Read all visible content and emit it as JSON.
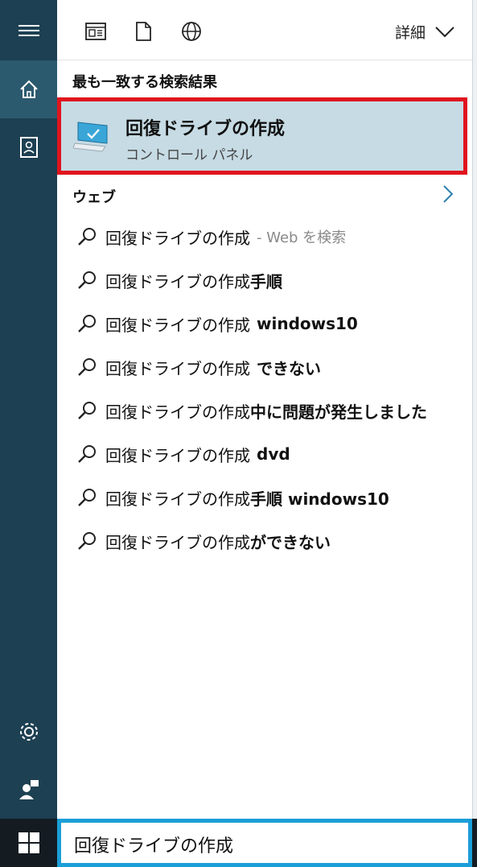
{
  "top": {
    "icons": [
      "app-grid-icon",
      "document-icon",
      "globe-icon"
    ],
    "details_label": "詳細"
  },
  "best_match": {
    "section": "最も一致する検索結果",
    "title": "回復ドライブの作成",
    "subtitle": "コントロール パネル"
  },
  "web": {
    "section": "ウェブ",
    "suggestions": [
      {
        "base": "回復ドライブの作成",
        "extra": "- Web を検索"
      },
      {
        "base": "回復ドライブの作成",
        "extra": "手順"
      },
      {
        "base": "回復ドライブの作成",
        "extra": "windows10"
      },
      {
        "base": "回復ドライブの作成",
        "extra": "できない"
      },
      {
        "base": "回復ドライブの作成",
        "extra": "中に問題が発生しました"
      },
      {
        "base": "回復ドライブの作成",
        "extra": "dvd"
      },
      {
        "base": "回復ドライブの作成",
        "extra": "手順 windows10"
      },
      {
        "base": "回復ドライブの作成",
        "extra": "ができない"
      }
    ]
  },
  "search": {
    "value": "回復ドライブの作成"
  },
  "colors": {
    "rail": "#1d4052",
    "best_bg": "#c6dbe4",
    "highlight_border": "#e0141e",
    "search_border": "#1b9ed8"
  }
}
